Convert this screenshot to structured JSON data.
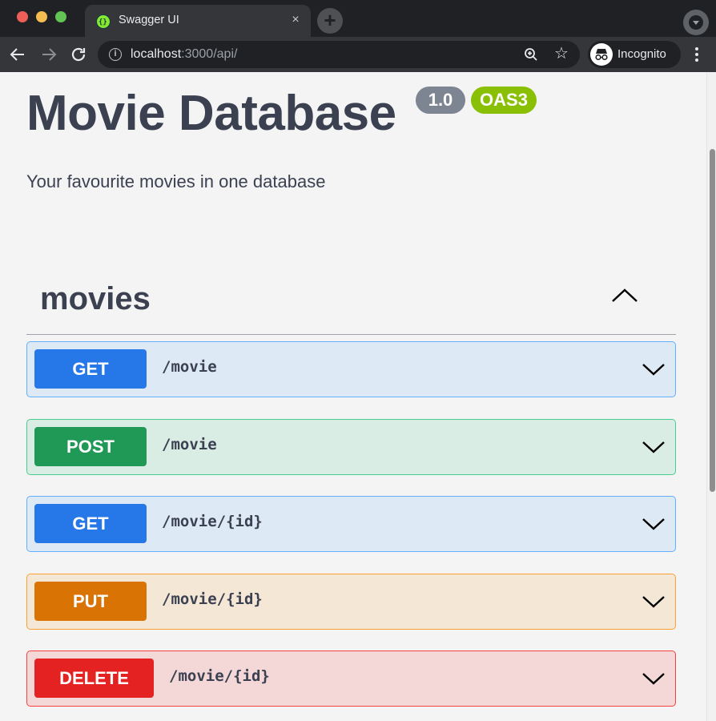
{
  "browser": {
    "tab_title": "Swagger UI",
    "tab_close": "×",
    "new_tab": "+",
    "url_host": "localhost",
    "url_rest": ":3000/api/",
    "info_glyph": "i",
    "star_glyph": "☆",
    "incognito_label": "Incognito",
    "icons": [
      "back-icon",
      "forward-icon",
      "reload-icon",
      "info-icon",
      "zoom-icon",
      "star-icon",
      "incognito-icon",
      "menu-icon"
    ]
  },
  "api": {
    "title": "Movie Database",
    "version": "1.0",
    "spec_badge": "OAS3",
    "description": "Your favourite movies in one database"
  },
  "tag": {
    "name": "movies",
    "expanded": true
  },
  "operations": [
    {
      "method": "GET",
      "path": "/movie",
      "color": "#61affe",
      "method_color": "#2677e7"
    },
    {
      "method": "POST",
      "path": "/movie",
      "color": "#49cc90",
      "method_color": "#219956"
    },
    {
      "method": "GET",
      "path": "/movie/{id}",
      "color": "#61affe",
      "method_color": "#2677e7"
    },
    {
      "method": "PUT",
      "path": "/movie/{id}",
      "color": "#fca130",
      "method_color": "#d97304"
    },
    {
      "method": "DELETE",
      "path": "/movie/{id}",
      "color": "#f93e3e",
      "method_color": "#e42222"
    }
  ],
  "colors": {
    "page_bg": "#f4f4f4",
    "text": "#3b4151",
    "badge_version": "#7d8492",
    "badge_oas": "#89bf04"
  }
}
